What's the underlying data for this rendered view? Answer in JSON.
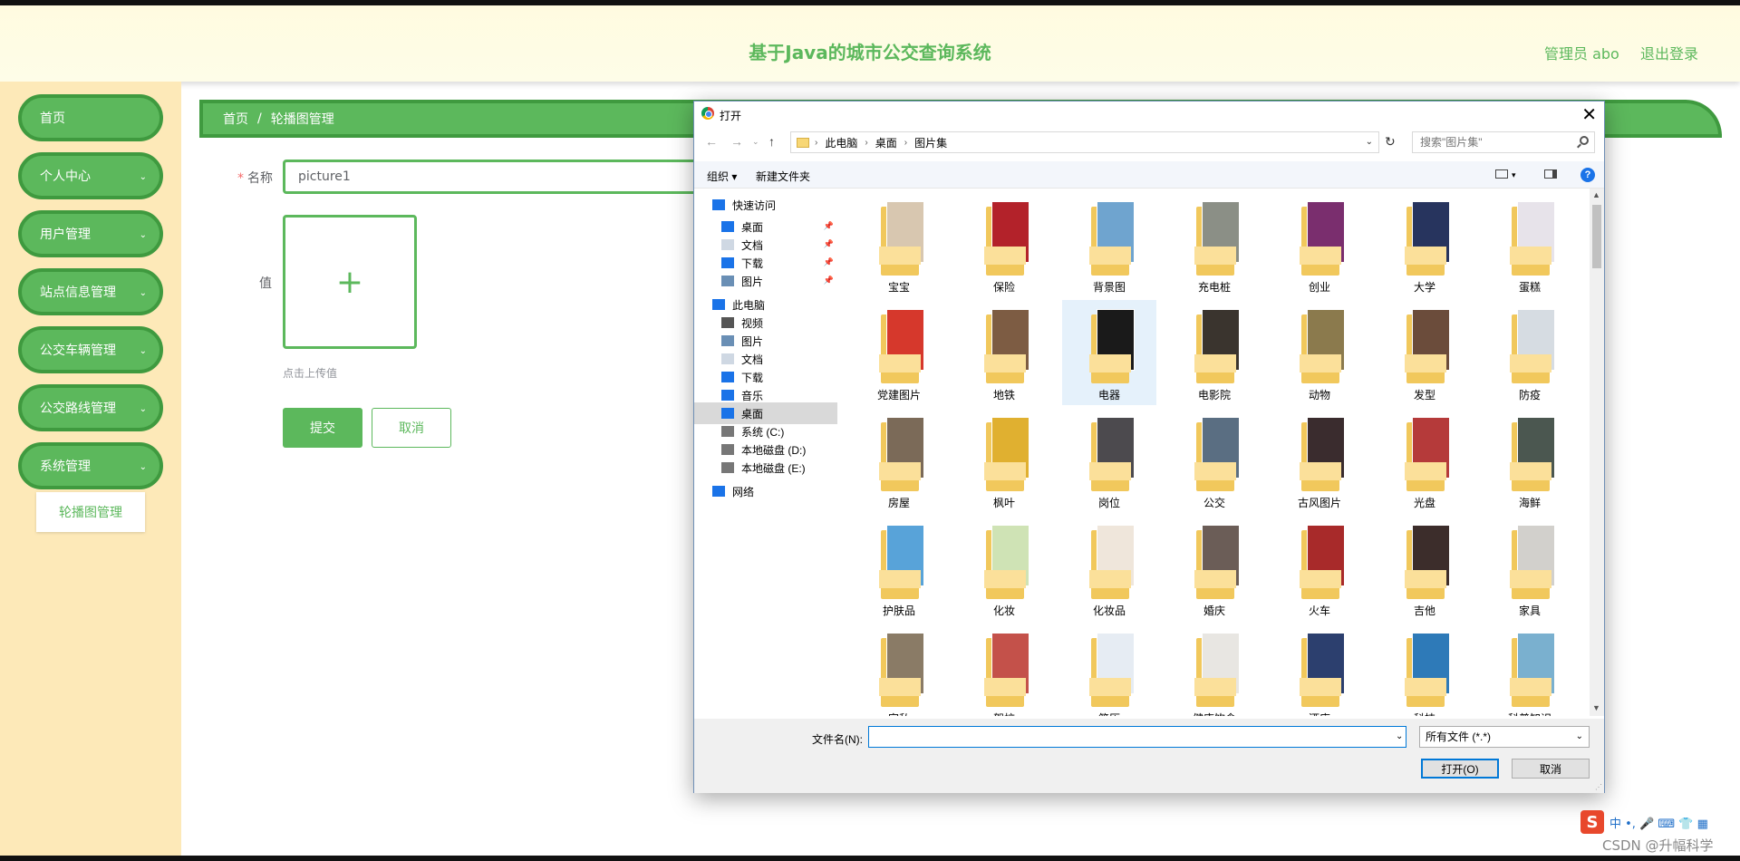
{
  "header": {
    "title": "基于Java的城市公交查询系统",
    "user": "管理员 abo",
    "logout": "退出登录"
  },
  "sidebar": {
    "items": [
      {
        "label": "首页",
        "arrow": ""
      },
      {
        "label": "个人中心",
        "arrow": "⌄"
      },
      {
        "label": "用户管理",
        "arrow": "⌄"
      },
      {
        "label": "站点信息管理",
        "arrow": "⌄"
      },
      {
        "label": "公交车辆管理",
        "arrow": "⌄"
      },
      {
        "label": "公交路线管理",
        "arrow": "⌄"
      },
      {
        "label": "系统管理",
        "arrow": "⌄"
      }
    ],
    "submenu_item": "轮播图管理"
  },
  "breadcrumb": {
    "home": "首页",
    "sep": "/",
    "current": "轮播图管理"
  },
  "form": {
    "name_label": "名称",
    "required_mark": "*",
    "name_value": "picture1",
    "value_label": "值",
    "upload_plus": "+",
    "upload_tip": "点击上传值",
    "submit": "提交",
    "cancel": "取消"
  },
  "dialog": {
    "title": "打开",
    "close": "✕",
    "path": [
      "此电脑",
      "桌面",
      "图片集"
    ],
    "path_sep": "›",
    "search_placeholder": "搜索\"图片集\"",
    "toolbar": {
      "organize": "组织 ▾",
      "new_folder": "新建文件夹",
      "help": "?"
    },
    "nav": [
      {
        "label": "快速访问",
        "icon": "star-icon",
        "pinned": false,
        "indent": 1,
        "selected": false
      },
      {
        "label": "桌面",
        "icon": "desktop-icon",
        "pinned": true,
        "indent": 2,
        "selected": false
      },
      {
        "label": "文档",
        "icon": "document-icon",
        "pinned": true,
        "indent": 2,
        "selected": false
      },
      {
        "label": "下载",
        "icon": "download-icon",
        "pinned": true,
        "indent": 2,
        "selected": false
      },
      {
        "label": "图片",
        "icon": "picture-icon",
        "pinned": true,
        "indent": 2,
        "selected": false
      },
      {
        "label": "此电脑",
        "icon": "computer-icon",
        "pinned": false,
        "indent": 1,
        "selected": false
      },
      {
        "label": "视频",
        "icon": "video-icon",
        "pinned": false,
        "indent": 2,
        "selected": false
      },
      {
        "label": "图片",
        "icon": "picture-icon",
        "pinned": false,
        "indent": 2,
        "selected": false
      },
      {
        "label": "文档",
        "icon": "document-icon",
        "pinned": false,
        "indent": 2,
        "selected": false
      },
      {
        "label": "下载",
        "icon": "download-icon",
        "pinned": false,
        "indent": 2,
        "selected": false
      },
      {
        "label": "音乐",
        "icon": "music-icon",
        "pinned": false,
        "indent": 2,
        "selected": false
      },
      {
        "label": "桌面",
        "icon": "desktop-icon",
        "pinned": false,
        "indent": 2,
        "selected": true
      },
      {
        "label": "系统 (C:)",
        "icon": "drive-icon",
        "pinned": false,
        "indent": 2,
        "selected": false
      },
      {
        "label": "本地磁盘 (D:)",
        "icon": "drive-icon",
        "pinned": false,
        "indent": 2,
        "selected": false
      },
      {
        "label": "本地磁盘 (E:)",
        "icon": "drive-icon",
        "pinned": false,
        "indent": 2,
        "selected": false
      },
      {
        "label": "网络",
        "icon": "network-icon",
        "pinned": false,
        "indent": 1,
        "selected": false
      }
    ],
    "folders": [
      {
        "label": "宝宝",
        "color": "#d8c7b0"
      },
      {
        "label": "保险",
        "color": "#b3222a"
      },
      {
        "label": "背景图",
        "color": "#6fa4cf"
      },
      {
        "label": "充电桩",
        "color": "#8b8f86"
      },
      {
        "label": "创业",
        "color": "#7a2e6e"
      },
      {
        "label": "大学",
        "color": "#27345e"
      },
      {
        "label": "蛋糕",
        "color": "#e7e3ea"
      },
      {
        "label": "党建图片",
        "color": "#d6382c"
      },
      {
        "label": "地铁",
        "color": "#7d5c43"
      },
      {
        "label": "电器",
        "color": "#1a1a1a"
      },
      {
        "label": "电影院",
        "color": "#3a342e"
      },
      {
        "label": "动物",
        "color": "#8b7a4d"
      },
      {
        "label": "发型",
        "color": "#6b4c3b"
      },
      {
        "label": "防疫",
        "color": "#d6dce2"
      },
      {
        "label": "房屋",
        "color": "#7b6a58"
      },
      {
        "label": "枫叶",
        "color": "#e0b030"
      },
      {
        "label": "岗位",
        "color": "#4c4a4e"
      },
      {
        "label": "公交",
        "color": "#5a6e82"
      },
      {
        "label": "古风图片",
        "color": "#3a2c2e"
      },
      {
        "label": "光盘",
        "color": "#b53a3a"
      },
      {
        "label": "海鲜",
        "color": "#4b5750"
      },
      {
        "label": "护肤品",
        "color": "#58a3d9"
      },
      {
        "label": "化妆",
        "color": "#cfe3b5"
      },
      {
        "label": "化妆品",
        "color": "#efe6db"
      },
      {
        "label": "婚庆",
        "color": "#6b5d57"
      },
      {
        "label": "火车",
        "color": "#a82a2a"
      },
      {
        "label": "吉他",
        "color": "#3c2d2b"
      },
      {
        "label": "家具",
        "color": "#d2d0cc"
      },
      {
        "label": "家私",
        "color": "#8a7b66"
      },
      {
        "label": "驾校",
        "color": "#c4514a"
      },
      {
        "label": "简历",
        "color": "#e6ecf3"
      },
      {
        "label": "健康饮食",
        "color": "#e8e6e2"
      },
      {
        "label": "酒店",
        "color": "#2c3f6e"
      },
      {
        "label": "科技",
        "color": "#2e7ab8"
      },
      {
        "label": "科普知识",
        "color": "#7ab0cf"
      }
    ],
    "filename_label": "文件名(N):",
    "filename_value": "",
    "filetype": "所有文件 (*.*)",
    "open": "打开(O)",
    "cancel": "取消"
  },
  "ime": {
    "logo": "S",
    "mode": "中 •, 🎤 ⌨ 👕 ▦"
  },
  "watermark": "CSDN @升幅科学"
}
